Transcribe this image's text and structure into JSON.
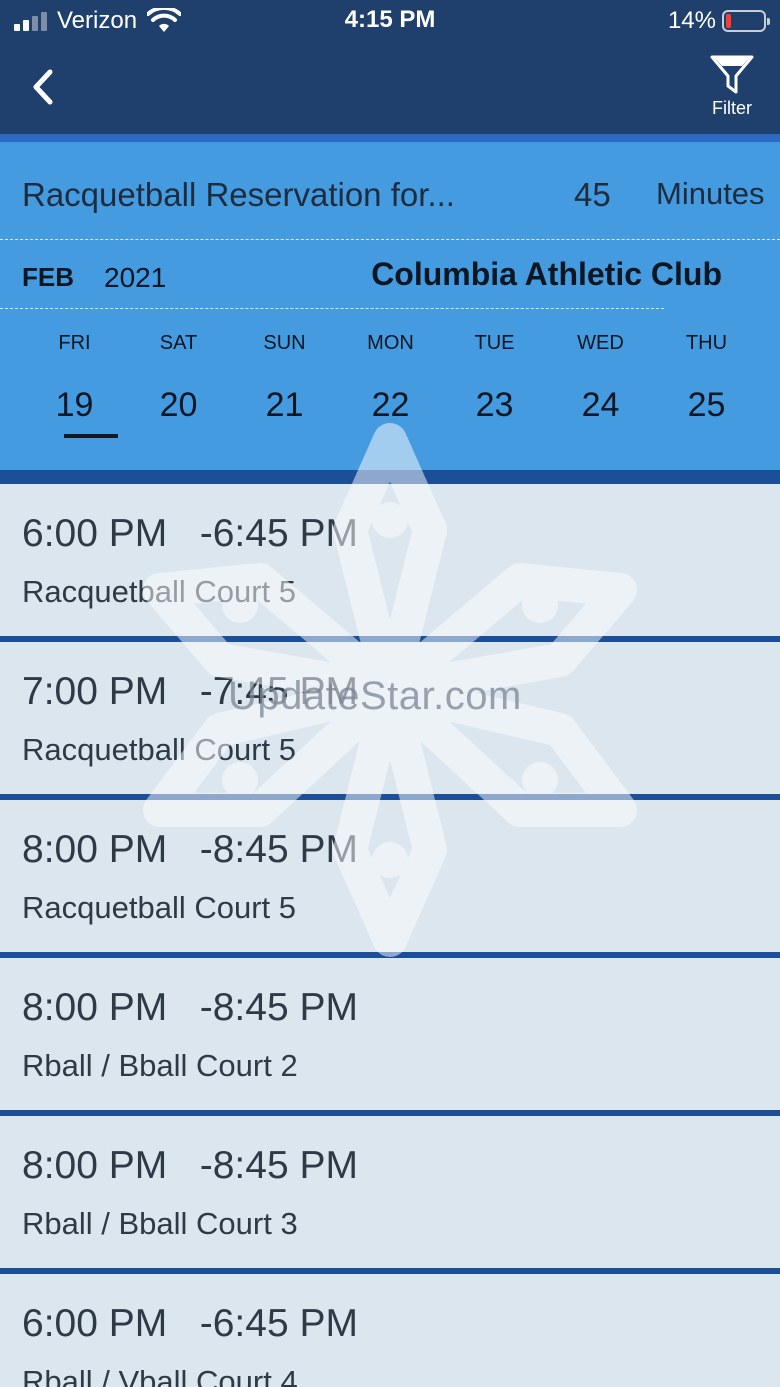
{
  "status_bar": {
    "carrier": "Verizon",
    "time": "4:15 PM",
    "battery_percent": "14%",
    "battery_level": 0.14,
    "battery_color": "#ff3b30"
  },
  "nav": {
    "back_icon": "chevron-left-icon",
    "filter_icon": "funnel-icon",
    "filter_label": "Filter"
  },
  "header": {
    "title": "Racquetball Reservation for...",
    "duration_value": "45",
    "duration_unit": "Minutes",
    "month": "FEB",
    "year": "2021",
    "club": "Columbia Athletic Club"
  },
  "days": [
    {
      "name": "FRI",
      "num": "19",
      "selected": true
    },
    {
      "name": "SAT",
      "num": "20",
      "selected": false
    },
    {
      "name": "SUN",
      "num": "21",
      "selected": false
    },
    {
      "name": "MON",
      "num": "22",
      "selected": false
    },
    {
      "name": "TUE",
      "num": "23",
      "selected": false
    },
    {
      "name": "WED",
      "num": "24",
      "selected": false
    },
    {
      "name": "THU",
      "num": "25",
      "selected": false
    }
  ],
  "slots": [
    {
      "time": "6:00 PM   -6:45 PM",
      "court": "Racquetball Court 5"
    },
    {
      "time": "7:00 PM   -7:45 PM",
      "court": "Racquetball Court 5"
    },
    {
      "time": "8:00 PM   -8:45 PM",
      "court": "Racquetball Court 5"
    },
    {
      "time": "8:00 PM   -8:45 PM",
      "court": "Rball / Bball Court 2"
    },
    {
      "time": "8:00 PM   -8:45 PM",
      "court": "Rball / Bball Court 3"
    },
    {
      "time": "6:00 PM   -6:45 PM",
      "court": "Rball / Vball Court 4"
    }
  ],
  "watermark": "UpdateStar.com",
  "colors": {
    "nav_bg": "#1f3f6d",
    "header_bg": "#449be0",
    "list_bg": "#dce6ef",
    "separator": "#1d4f99"
  }
}
